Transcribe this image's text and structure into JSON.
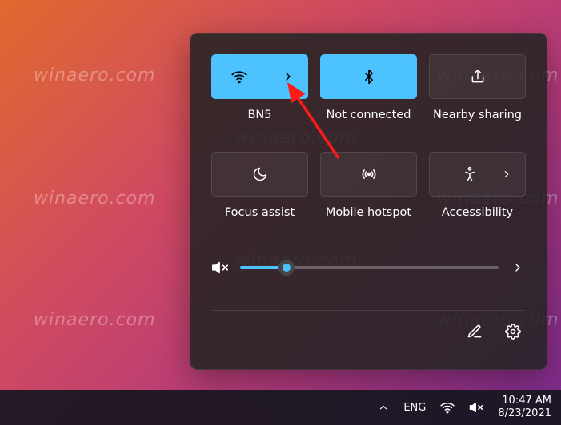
{
  "watermark": "winaero.com",
  "panel": {
    "tiles": [
      {
        "label": "BN5",
        "icon": "wifi",
        "active": true,
        "hasChevron": true
      },
      {
        "label": "Not connected",
        "icon": "bluetooth",
        "active": true,
        "hasChevron": false
      },
      {
        "label": "Nearby sharing",
        "icon": "share",
        "active": false,
        "hasChevron": false
      },
      {
        "label": "Focus assist",
        "icon": "moon",
        "active": false,
        "hasChevron": false
      },
      {
        "label": "Mobile hotspot",
        "icon": "hotspot",
        "active": false,
        "hasChevron": false
      },
      {
        "label": "Accessibility",
        "icon": "a11y",
        "active": false,
        "hasChevron": true
      }
    ],
    "volume": {
      "percent": 18
    },
    "colors": {
      "accent": "#4cc2ff"
    }
  },
  "taskbar": {
    "lang": "ENG",
    "time": "10:47 AM",
    "date": "8/23/2021"
  }
}
